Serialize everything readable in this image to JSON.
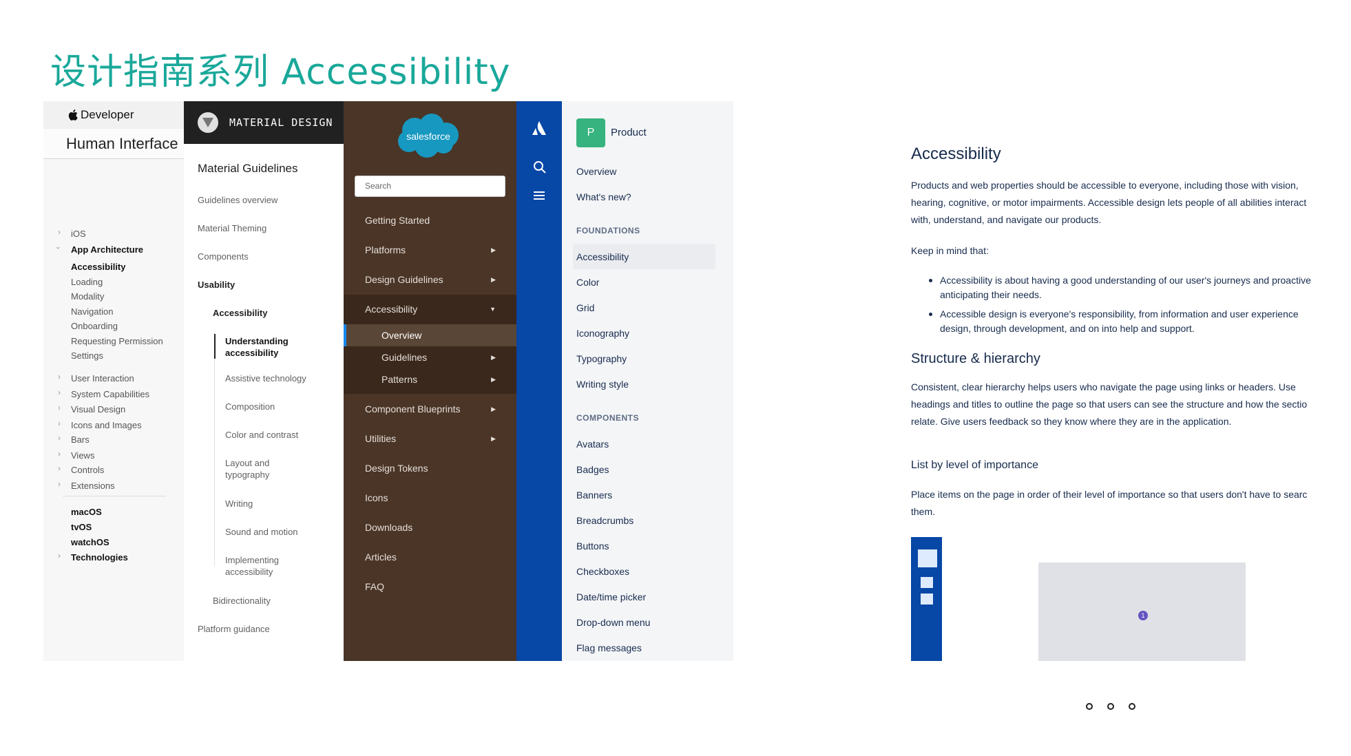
{
  "slide": {
    "title": "设计指南系列 Accessibility"
  },
  "apple": {
    "brand": "Developer",
    "section_title": "Human Interface",
    "platforms_top": [
      "iOS"
    ],
    "group_open": "App Architecture",
    "group_items": [
      "Accessibility",
      "Loading",
      "Modality",
      "Navigation",
      "Onboarding",
      "Requesting Permission",
      "Settings"
    ],
    "collapsed_groups": [
      "User Interaction",
      "System Capabilities",
      "Visual Design",
      "Icons and Images",
      "Bars",
      "Views",
      "Controls",
      "Extensions"
    ],
    "platforms_bottom": [
      "macOS",
      "tvOS",
      "watchOS",
      "Technologies"
    ]
  },
  "material": {
    "brand": "MATERIAL DESIGN",
    "heading": "Material Guidelines",
    "items": [
      "Guidelines overview",
      "Material Theming",
      "Components"
    ],
    "usability": "Usability",
    "accessibility": "Accessibility",
    "sub_items": [
      "Understanding accessibility",
      "Assistive technology",
      "Composition",
      "Color and contrast",
      "Layout and typography",
      "Writing",
      "Sound and motion",
      "Implementing accessibility"
    ],
    "bidirectionality": "Bidirectionality",
    "platform_guidance": "Platform guidance"
  },
  "salesforce": {
    "logo_text": "salesforce",
    "search_placeholder": "Search",
    "items_top": [
      "Getting Started",
      "Platforms",
      "Design Guidelines"
    ],
    "accessibility": "Accessibility",
    "sub_items": [
      "Overview",
      "Guidelines",
      "Patterns"
    ],
    "items_bottom": [
      "Component Blueprints",
      "Utilities",
      "Design Tokens",
      "Icons",
      "Downloads",
      "Articles",
      "FAQ"
    ]
  },
  "atlassian": {
    "product_initial": "P",
    "product_name": "Product",
    "top_items": [
      "Overview",
      "What's new?"
    ],
    "foundations_label": "FOUNDATIONS",
    "foundations": [
      "Accessibility",
      "Color",
      "Grid",
      "Iconography",
      "Typography",
      "Writing style"
    ],
    "components_label": "COMPONENTS",
    "components": [
      "Avatars",
      "Badges",
      "Banners",
      "Breadcrumbs",
      "Buttons",
      "Checkboxes",
      "Date/time picker",
      "Drop-down menu",
      "Flag messages"
    ]
  },
  "article": {
    "title": "Accessibility",
    "intro_lines": [
      "Products and web properties should be accessible to everyone, including those with vision,",
      "hearing, cognitive, or motor impairments. Accessible design lets people of all abilities interact",
      "with, understand, and navigate our products."
    ],
    "keep_in_mind": "Keep in mind that:",
    "bullets": [
      [
        "Accessibility is about having a good understanding of our user's journeys and proactive",
        "anticipating their needs."
      ],
      [
        "Accessible design is everyone's responsibility, from information and user experience",
        "design, through development, and on into help and support."
      ]
    ],
    "structure_heading": "Structure & hierarchy",
    "structure_lines": [
      "Consistent, clear hierarchy helps users who navigate the page using links or headers. Use",
      "headings and titles to outline the page so that users can see the structure and how the sectio",
      "relate. Give users feedback so they know where they are in the application."
    ],
    "list_heading": "List by level of importance",
    "list_lines": [
      "Place items on the page in order of their level of importance so that users don't have to searc",
      "them."
    ],
    "badge_number": "1"
  },
  "colors": {
    "title_teal": "#1aa89a",
    "salesforce_brown": "#4a3527",
    "atlassian_blue": "#0747a6",
    "atlassian_green": "#36b37e",
    "salesforce_blue": "#1589ee"
  }
}
